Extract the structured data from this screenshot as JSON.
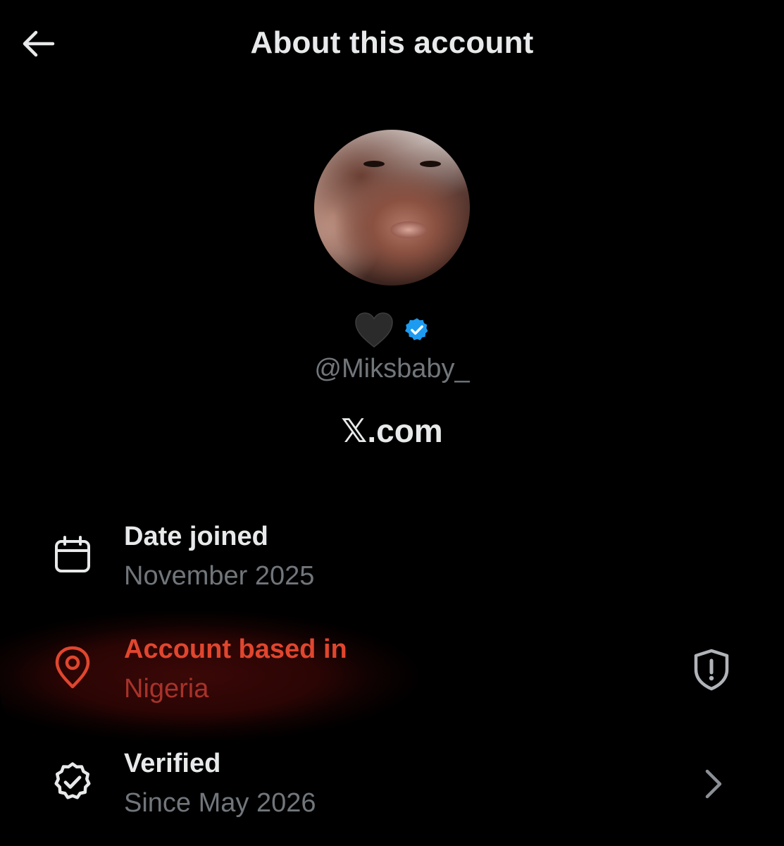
{
  "header": {
    "title": "About this account",
    "back_icon": "arrow-left-icon"
  },
  "profile": {
    "display_name_emoji": "🖤",
    "verified_badge_color": "#1d9bf0",
    "handle": "@Miksbaby_",
    "domain": "𝕏.com"
  },
  "rows": [
    {
      "icon": "calendar-icon",
      "title": "Date joined",
      "value": "November 2025"
    },
    {
      "icon": "location-pin-icon",
      "title": "Account based in",
      "value": "Nigeria",
      "trailing_icon": "shield-alert-icon"
    },
    {
      "icon": "verified-badge-icon",
      "title": "Verified",
      "value": "Since May 2026",
      "trailing_icon": "chevron-right-icon"
    }
  ],
  "colors": {
    "background": "#000000",
    "primary_text": "#e7e9ea",
    "secondary_text": "#71767b",
    "highlight_red": "#e0462e",
    "verified_blue": "#1d9bf0"
  }
}
